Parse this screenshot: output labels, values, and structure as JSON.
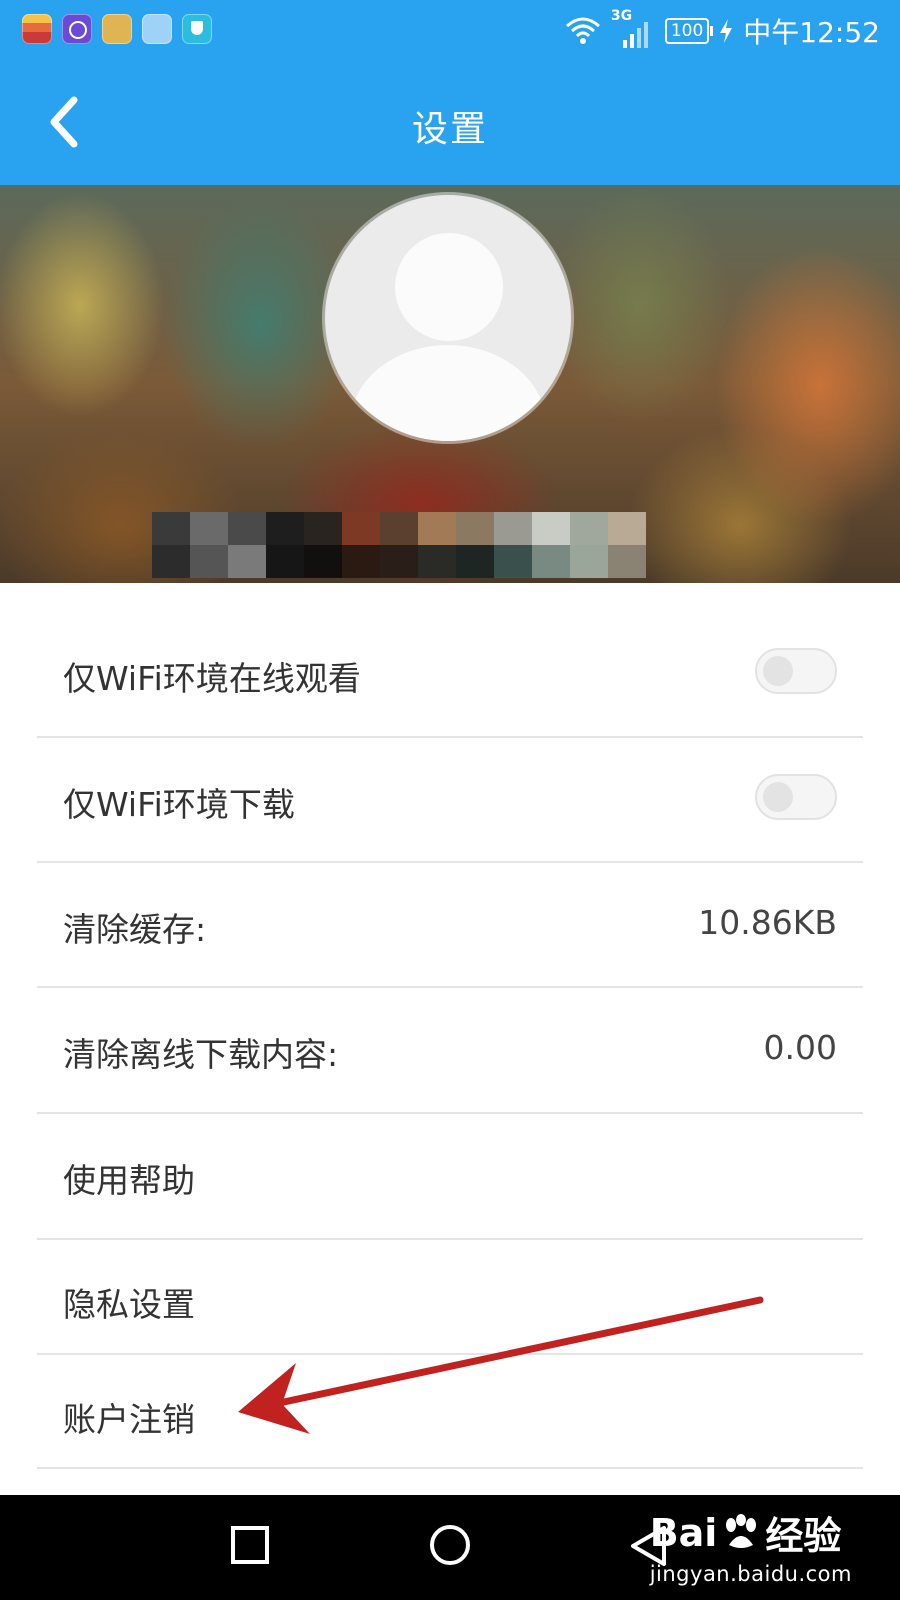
{
  "status_bar": {
    "clock": "中午12:52",
    "network": "3G",
    "battery": "100",
    "app_icons": [
      "huawei-folder-icon",
      "browser-icon",
      "files-icon",
      "huawei-store-icon",
      "phone-manager-icon"
    ]
  },
  "header": {
    "title": "设置",
    "background": "#29a3f0"
  },
  "settings": {
    "wifi_online": {
      "label": "仅WiFi环境在线观看",
      "enabled": false
    },
    "wifi_download": {
      "label": "仅WiFi环境下载",
      "enabled": false
    },
    "clear_cache": {
      "label": "清除缓存:",
      "value": "10.86KB"
    },
    "clear_offline": {
      "label": "清除离线下载内容:",
      "value": "0.00"
    },
    "help": {
      "label": "使用帮助"
    },
    "privacy": {
      "label": "隐私设置"
    },
    "account_cancel": {
      "label": "账户注销"
    }
  },
  "annotation": {
    "color": "#c0221f",
    "target": "账户注销"
  },
  "watermark": {
    "brand_prefix": "Bai",
    "brand_suffix": "经验",
    "url": "jingyan.baidu.com"
  }
}
